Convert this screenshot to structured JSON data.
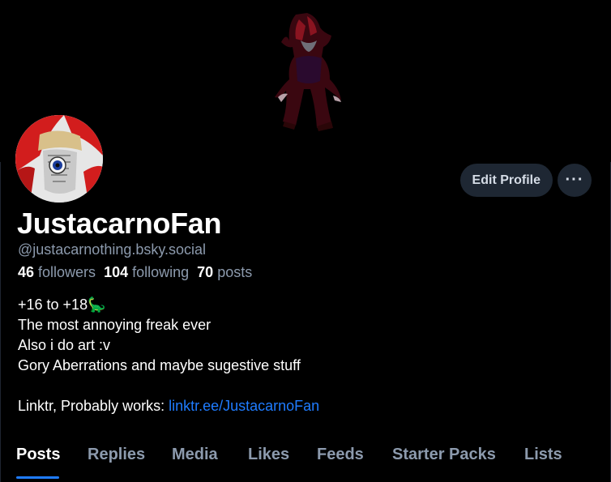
{
  "banner": {
    "icon": "banner-artwork"
  },
  "avatar": {
    "icon": "avatar-artwork"
  },
  "actions": {
    "edit_label": "Edit Profile",
    "more_label": "···"
  },
  "profile": {
    "display_name": "JustacarnoFan",
    "handle": "@justacarnothing.bsky.social",
    "followers_count": "46",
    "followers_label": "followers",
    "following_count": "104",
    "following_label": "following",
    "posts_count": "70",
    "posts_label": "posts"
  },
  "bio": {
    "line1": "+16 to +18🦕",
    "line2": "The most annoying freak ever",
    "line3": "Also i do art :v",
    "line4": "Gory Aberrations and maybe sugestive stuff",
    "line6_prefix": "Linktr, Probably works: ",
    "link": "linktr.ee/JustacarnoFan"
  },
  "tabs": [
    "Posts",
    "Replies",
    "Media",
    "Likes",
    "Feeds",
    "Starter Packs",
    "Lists"
  ],
  "colors": {
    "accent": "#1f7cff",
    "muted": "#8c9aad",
    "button_bg": "#1e2733"
  }
}
